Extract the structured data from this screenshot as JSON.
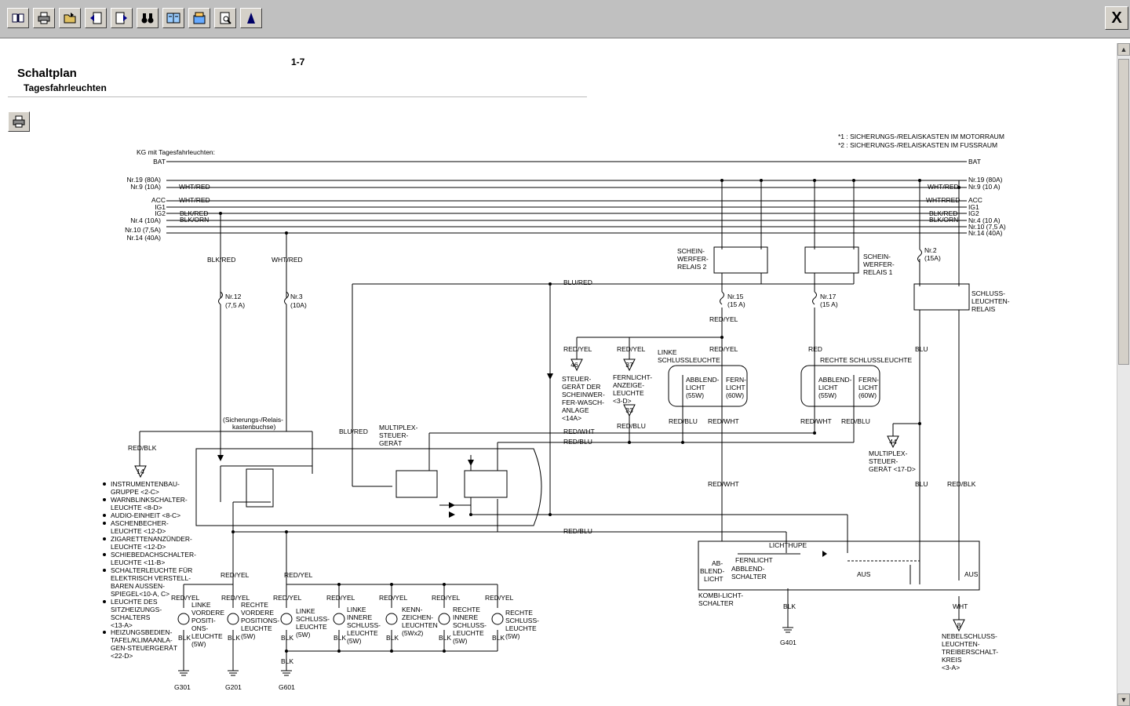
{
  "toolbar": {
    "buttons": [
      {
        "name": "book-icon"
      },
      {
        "name": "printer-icon"
      },
      {
        "name": "folder-icon"
      },
      {
        "name": "back-icon"
      },
      {
        "name": "forward-icon"
      },
      {
        "name": "binoculars-icon"
      },
      {
        "name": "manual-icon"
      },
      {
        "name": "index-icon"
      },
      {
        "name": "preview-icon"
      },
      {
        "name": "highlight-icon"
      }
    ],
    "close_label": "X"
  },
  "page": {
    "title": "Schaltplan",
    "subtitle": "Tagesfahrleuchten",
    "number": "1-7"
  },
  "diagram": {
    "header": "KG mit Tagesfahrleuchten:",
    "notes": [
      "*1 : SICHERUNGS-/RELAISKASTEN IM MOTORRAUM",
      "*2 : SICHERUNGS-/RELAISKASTEN IM FUSSRAUM"
    ],
    "left_rails": [
      "BAT",
      "Nr.19 (80A)",
      "Nr.9 (10A)",
      "ACC",
      "IG1",
      "IG2",
      "Nr.4 (10A)",
      "Nr.10 (7,5A)",
      "Nr.14 (40A)"
    ],
    "right_rails": [
      "BAT",
      "Nr.19 (80A)",
      "Nr.9 (10 A)",
      "ACC",
      "IG1",
      "IG2",
      "Nr.4 (10 A)",
      "Nr.10 (7,5 A)",
      "Nr.14 (40A)"
    ],
    "wire_labels": {
      "wht_red": "WHT/RED",
      "blk_red": "BLK/RED",
      "blk_orn": "BLK/ORN",
      "blu_red": "BLU/RED",
      "red_yel": "RED/YEL",
      "red_blk": "RED/BLK",
      "red_wht": "RED/WHT",
      "red_blu": "RED/BLU",
      "red": "RED",
      "blu": "BLU",
      "blk": "BLK",
      "wht": "WHT",
      "whtred": "WHTRRED",
      "blurd": "BLU/RED"
    },
    "fuses": {
      "nr12": "Nr.12",
      "nr12_a": "(7,5 A)",
      "nr3": "Nr.3",
      "nr3_a": "(10A)",
      "nr15": "Nr.15",
      "nr15_a": "(15 A)",
      "nr17": "Nr.17",
      "nr17_a": "(15 A)",
      "nr2": "Nr.2",
      "nr2_a": "(15A)"
    },
    "relays": {
      "scheinwerfer2": [
        "SCHEIN-",
        "WERFER-",
        "RELAIS 2"
      ],
      "scheinwerfer1": [
        "SCHEIN-",
        "WERFER-",
        "RELAIS 1"
      ],
      "schluss": [
        "SCHLUSS-",
        "LEUCHTEN-",
        "RELAIS"
      ]
    },
    "components": {
      "steuergeraet": [
        "STEUER-",
        "GERÄT DER",
        "SCHEINWER-",
        "FER-WASCH-",
        "ANLAGE",
        "<14A>"
      ],
      "fernlicht_anzeige": [
        "FERNLICHT-",
        "ANZEIGE-",
        "LEUCHTE",
        "<3-D>"
      ],
      "linke_schluss_top": [
        "LINKE",
        "SCHLUSSLEUCHTE"
      ],
      "rechte_schluss_top": "RECHTE SCHLUSSLEUCHTE",
      "abblend": [
        "ABBLEND-",
        "LICHT",
        "(55W)"
      ],
      "fern": [
        "FERN-",
        "LICHT",
        "(60W)"
      ],
      "multiplex1": [
        "MULTIPLEX-",
        "STEUER-",
        "GERÄT"
      ],
      "multiplex2": [
        "MULTIPLEX-",
        "STEUER-",
        "GERÄT <17-D>"
      ],
      "kasten": [
        "(Sicherungs-/Relais-",
        "kastenbuchse)"
      ],
      "kombi": [
        "KOMBI-LICHT-",
        "SCHALTER"
      ],
      "lichthupe": "LICHTHUPE",
      "fernlicht_sw": "FERNLICHT",
      "abblend_sw": [
        "ABBLEND-",
        "SCHALTER"
      ],
      "ab_licht": [
        "AB-",
        "BLEND-",
        "LICHT"
      ],
      "aus": "AUS",
      "nebel": [
        "NEBELSCHLUSS-",
        "LEUCHTEN-",
        "TREIBERSCHALT-",
        "KREIS",
        "<3-A>"
      ]
    },
    "lamps": [
      {
        "lines": [
          "LINKE",
          "VORDERE",
          "POSITI-",
          "ONS-",
          "LEUCHTE",
          "(5W)"
        ]
      },
      {
        "lines": [
          "RECHTE",
          "VORDERE",
          "POSITIONS-",
          "LEUCHTE",
          "(5W)"
        ]
      },
      {
        "lines": [
          "LINKE",
          "SCHLUSS-",
          "LEUCHTE",
          "(5W)"
        ]
      },
      {
        "lines": [
          "LINKE",
          "INNERE",
          "SCHLUSS-",
          "LEUCHTE",
          "(5W)"
        ]
      },
      {
        "lines": [
          "KENN-",
          "ZEICHEN-",
          "LEUCHTEN",
          "(5Wx2)"
        ]
      },
      {
        "lines": [
          "RECHTE",
          "INNERE",
          "SCHLUSS-",
          "LEUCHTE",
          "(5W)"
        ]
      },
      {
        "lines": [
          "RECHTE",
          "SCHLUSS-",
          "LEUCHTE",
          "(5W)"
        ]
      }
    ],
    "connectors": {
      "c14": "14",
      "c46": "46",
      "c37": "37",
      "c33": "33",
      "c44": "44",
      "c8": "8"
    },
    "grounds": [
      "G301",
      "G201",
      "G601",
      "G401"
    ],
    "list": [
      [
        "INSTRUMENTENBAU-",
        "GRUPPE <2-C>"
      ],
      [
        "WARNBLINKSCHALTER-",
        "LEUCHTE <8-D>"
      ],
      [
        "AUDIO-EINHEIT <8-C>"
      ],
      [
        "ASCHENBECHER-",
        "LEUCHTE <12-D>"
      ],
      [
        "ZIGARETTENANZÜNDER-",
        "LEUCHTE <12-D>"
      ],
      [
        "SCHIEBEDACHSCHALTER-",
        "LEUCHTE <11-B>"
      ],
      [
        "SCHALTERLEUCHTE FÜR",
        "ELEKTRISCH VERSTELL-",
        "BAREN AUSSEN-",
        "SPIEGEL<10-A, C>"
      ],
      [
        "LEUCHTE DES",
        "SITZHEIZUNGS-",
        "SCHALTERS",
        "<13-A>"
      ],
      [
        "HEIZUNGSBEDIEN-",
        "TAFEL/KLIMAANLA-",
        "GEN-STEUERGERÄT",
        "<22-D>"
      ]
    ]
  }
}
